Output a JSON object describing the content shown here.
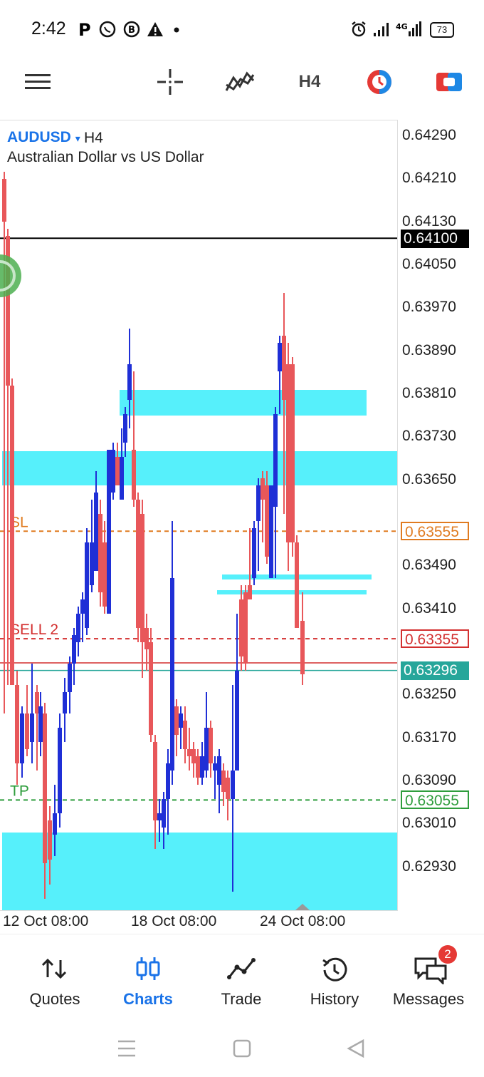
{
  "status_bar": {
    "time": "2:42",
    "left_icons": [
      "p-icon",
      "whatsapp-icon",
      "b-icon",
      "warning-icon",
      "dot-icon"
    ],
    "battery": "73"
  },
  "toolbar": {
    "timeframe": "H4",
    "icons": [
      "menu-icon",
      "crosshair-icon",
      "indicators-icon",
      "timeframe-label",
      "trade-clock-icon",
      "one-click-trade-icon"
    ]
  },
  "chart": {
    "symbol": "AUDUSD",
    "symbol_arrow": "▾",
    "timeframe": "H4",
    "description": "Australian Dollar vs US Dollar",
    "price_ticks": [
      "0.64290",
      "0.64210",
      "0.64130",
      "0.64050",
      "0.63970",
      "0.63890",
      "0.63810",
      "0.63730",
      "0.63650",
      "0.63490",
      "0.63410",
      "0.63250",
      "0.63170",
      "0.63090",
      "0.63010",
      "0.62930"
    ],
    "time_ticks": [
      "12 Oct 08:00",
      "18 Oct 08:00",
      "24 Oct 08:00"
    ],
    "levels": {
      "black": {
        "price": "0.64100",
        "color": "#000000"
      },
      "sl": {
        "label": "SL",
        "price": "0.63555",
        "color": "#e07b20"
      },
      "sell": {
        "label": "SELL 2",
        "price": "0.63355",
        "color": "#d32f2f"
      },
      "bid": {
        "price": "0.63296",
        "color": "#26a69a"
      },
      "tp": {
        "label": "TP",
        "price": "0.63055",
        "color": "#2e9d3c"
      }
    },
    "colors": {
      "bull": "#1f2fd6",
      "bear": "#e8575a",
      "zone": "#56f0fb"
    }
  },
  "bottom_nav": {
    "items": [
      {
        "label": "Quotes",
        "icon": "quotes-icon"
      },
      {
        "label": "Charts",
        "icon": "charts-icon"
      },
      {
        "label": "Trade",
        "icon": "trade-icon"
      },
      {
        "label": "History",
        "icon": "history-icon"
      },
      {
        "label": "Messages",
        "icon": "messages-icon"
      }
    ],
    "active": "Charts",
    "messages_badge": "2"
  }
}
